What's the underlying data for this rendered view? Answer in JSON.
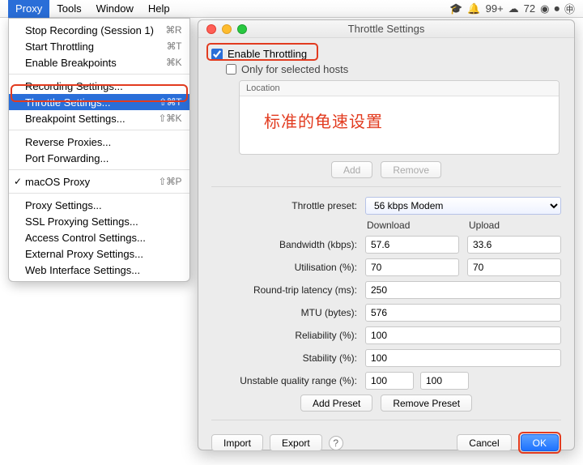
{
  "menubar": {
    "items": [
      "Proxy",
      "Tools",
      "Window",
      "Help"
    ],
    "active_index": 0,
    "status": {
      "badge1": "99+",
      "badge2": "72"
    }
  },
  "dropdown": {
    "items": [
      {
        "label": "Stop Recording (Session 1)",
        "shortcut": "⌘R"
      },
      {
        "label": "Start Throttling",
        "shortcut": "⌘T"
      },
      {
        "label": "Enable Breakpoints",
        "shortcut": "⌘K"
      },
      {
        "sep": true
      },
      {
        "label": "Recording Settings..."
      },
      {
        "label": "Throttle Settings...",
        "shortcut": "⇧⌘T",
        "selected": true
      },
      {
        "label": "Breakpoint Settings...",
        "shortcut": "⇧⌘K"
      },
      {
        "sep": true
      },
      {
        "label": "Reverse Proxies..."
      },
      {
        "label": "Port Forwarding..."
      },
      {
        "sep": true
      },
      {
        "label": "macOS Proxy",
        "shortcut": "⇧⌘P",
        "checked": true
      },
      {
        "sep": true
      },
      {
        "label": "Proxy Settings..."
      },
      {
        "label": "SSL Proxying Settings..."
      },
      {
        "label": "Access Control Settings..."
      },
      {
        "label": "External Proxy Settings..."
      },
      {
        "label": "Web Interface Settings..."
      }
    ]
  },
  "dialog": {
    "title": "Throttle Settings",
    "enable_label": "Enable Throttling",
    "enable_checked": true,
    "selected_hosts_label": "Only for selected hosts",
    "selected_hosts_checked": false,
    "hosts_header": "Location",
    "annotation": "标准的龟速设置",
    "buttons": {
      "add": "Add",
      "remove": "Remove",
      "add_preset": "Add Preset",
      "remove_preset": "Remove Preset",
      "import": "Import",
      "export": "Export",
      "cancel": "Cancel",
      "ok": "OK"
    },
    "form": {
      "preset_label": "Throttle preset:",
      "preset_value": "56 kbps Modem",
      "dl_header": "Download",
      "ul_header": "Upload",
      "bandwidth_label": "Bandwidth (kbps):",
      "bandwidth_dl": "57.6",
      "bandwidth_ul": "33.6",
      "util_label": "Utilisation (%):",
      "util_dl": "70",
      "util_ul": "70",
      "rtl_label": "Round-trip latency (ms):",
      "rtl": "250",
      "mtu_label": "MTU (bytes):",
      "mtu": "576",
      "reliability_label": "Reliability (%):",
      "reliability": "100",
      "stability_label": "Stability (%):",
      "stability": "100",
      "uqr_label": "Unstable quality range (%):",
      "uqr_lo": "100",
      "uqr_hi": "100"
    }
  }
}
